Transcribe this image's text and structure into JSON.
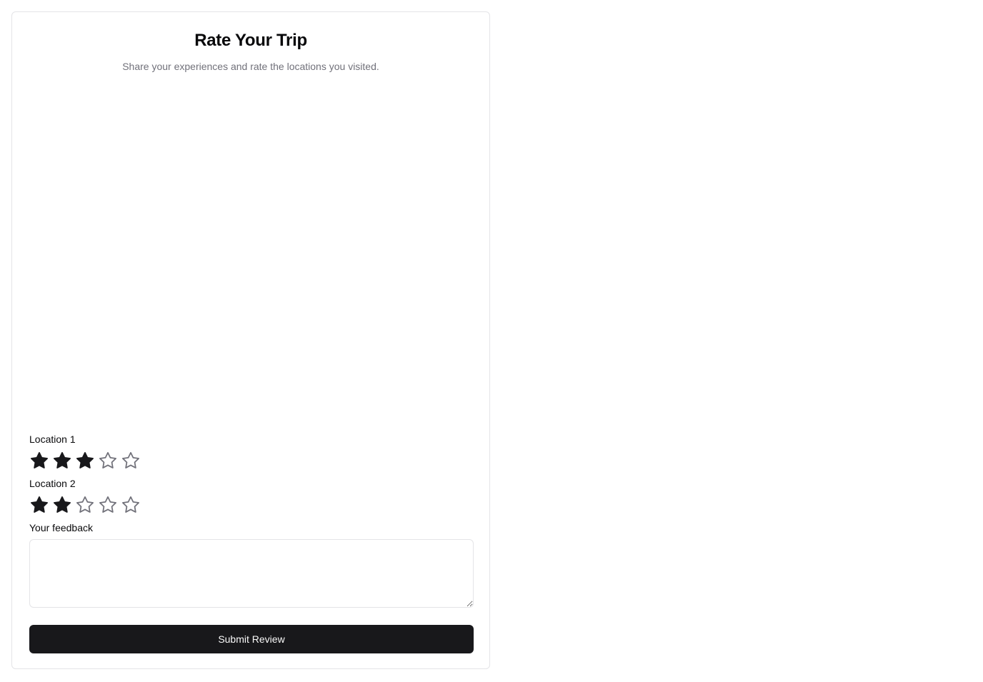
{
  "header": {
    "title": "Rate Your Trip",
    "subtitle": "Share your experiences and rate the locations you visited."
  },
  "locations": [
    {
      "label": "Location 1",
      "rating": 3,
      "max": 5
    },
    {
      "label": "Location 2",
      "rating": 2,
      "max": 5
    }
  ],
  "feedback": {
    "label": "Your feedback",
    "value": "",
    "placeholder": ""
  },
  "submit": {
    "label": "Submit Review"
  },
  "colors": {
    "star_filled": "#18181b",
    "star_empty_stroke": "#71717a",
    "button_bg": "#18181b",
    "button_text": "#fafafa",
    "border": "#e4e4e7",
    "muted_text": "#71717a"
  },
  "icons": {
    "filled": "star-filled-icon",
    "empty": "star-outline-icon"
  }
}
